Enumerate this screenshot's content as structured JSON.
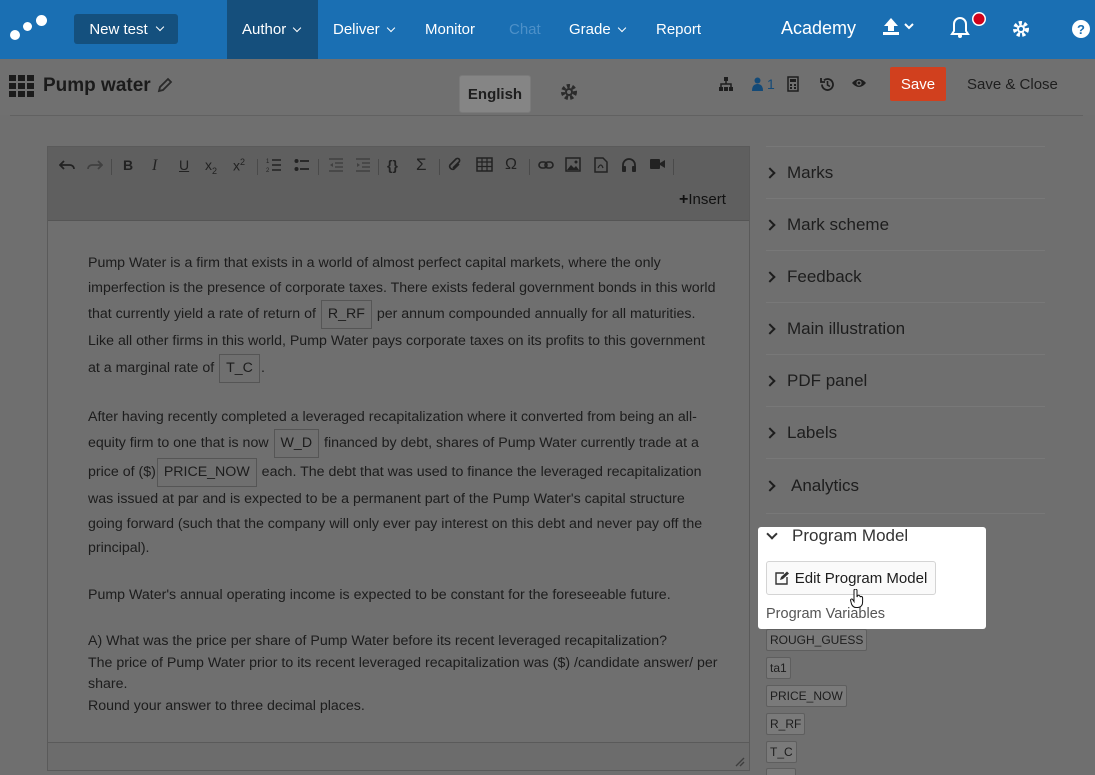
{
  "nav": {
    "new_test": "New test",
    "author": "Author",
    "deliver": "Deliver",
    "monitor": "Monitor",
    "chat": "Chat",
    "grade": "Grade",
    "report": "Report",
    "academy": "Academy"
  },
  "toolbar": {
    "title": "Pump water",
    "language": "English",
    "user_count": "1",
    "save": "Save",
    "save_close": "Save & Close"
  },
  "editor": {
    "insert": "Insert",
    "p1_a": "Pump Water is a firm that exists in a world of almost perfect capital markets, where the only imperfection is the presence of corporate taxes. There exists federal government bonds in this world that currently yield a rate of return of ",
    "var_rrf": "R_RF",
    "p1_b": " per annum compounded annually for all maturities. Like all other firms in this world, Pump Water pays corporate taxes on its profits to this government at a marginal rate of ",
    "var_tc": "T_C",
    "p1_c": ".",
    "p2_a": "After having recently completed a leveraged recapitalization where it converted from being an all-equity firm to one that is now ",
    "var_wd": "W_D",
    "p2_b": " financed by debt, shares of Pump Water currently trade at a price of ($)",
    "var_price": "PRICE_NOW",
    "p2_c": " each. The debt that was used to finance the leveraged recapitalization was issued at par and is expected to be a permanent part of the Pump Water's capital structure going forward (such that the company will only ever pay interest on this debt and never pay off the principal).",
    "p3": "Pump Water's annual operating income is expected to be constant for the foreseeable future.",
    "p4_q": "A) What was the price per share of Pump Water before its recent leveraged recapitalization?",
    "p4_a": "The price of Pump Water prior to its recent leveraged recapitalization was ($) /candidate answer/ per share.",
    "p4_r": "Round your answer to three decimal places."
  },
  "sidebar": {
    "items": [
      "Marks",
      "Mark scheme",
      "Feedback",
      "Main illustration",
      "PDF panel",
      "Labels",
      "Analytics"
    ],
    "program_model": "Program Model",
    "edit_program_model": "Edit Program Model",
    "program_variables": "Program Variables",
    "variables": [
      "ROUGH_GUESS",
      "ta1",
      "PRICE_NOW",
      "R_RF",
      "T_C"
    ]
  }
}
